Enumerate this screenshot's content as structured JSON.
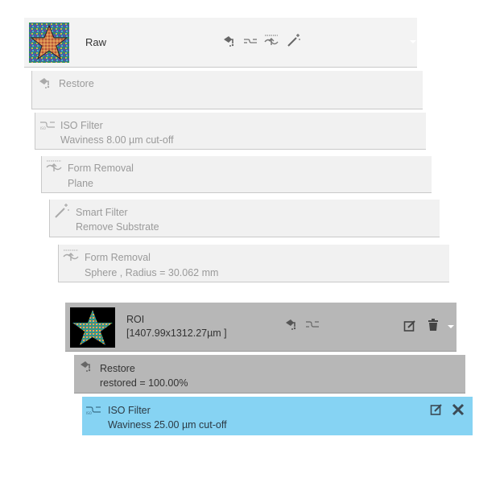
{
  "raw": {
    "title": "Raw",
    "icons": [
      "restore-icon",
      "iso-filter-icon",
      "form-removal-icon",
      "smart-filter-icon"
    ],
    "menu_icon": "chevron-down-icon"
  },
  "steps": [
    {
      "title": "Restore",
      "subtitle": "",
      "icon": "restore-icon"
    },
    {
      "title": "ISO Filter",
      "subtitle": "Waviness 8.00 µm cut-off",
      "icon": "iso-filter-icon"
    },
    {
      "title": "Form Removal",
      "subtitle": "Plane",
      "icon": "form-removal-icon"
    },
    {
      "title": "Smart Filter",
      "subtitle": "Remove Substrate",
      "icon": "smart-filter-icon"
    },
    {
      "title": "Form Removal",
      "subtitle": "Sphere , Radius = 30.062 mm",
      "icon": "form-removal-icon"
    }
  ],
  "roi": {
    "title": "ROI",
    "subtitle": "[1407.99x1312.27µm ]",
    "icons": [
      "restore-icon",
      "iso-filter-icon"
    ],
    "actions": [
      "edit-icon",
      "trash-icon",
      "chevron-down-icon"
    ]
  },
  "roi_steps": [
    {
      "title": "Restore",
      "subtitle": "restored = 100.00%",
      "icon": "restore-icon"
    },
    {
      "title": "ISO Filter",
      "subtitle": "Waviness 25.00 µm cut-off",
      "icon": "iso-filter-icon",
      "selected": true,
      "actions": [
        "edit-icon",
        "close-icon"
      ]
    }
  ],
  "colors": {
    "light_card": "#f1f1f1",
    "gray_card": "#b7b7b7",
    "selected_card": "#86d3f3",
    "text_dim": "#9a9a9a",
    "text_dark": "#3a3a3a"
  }
}
